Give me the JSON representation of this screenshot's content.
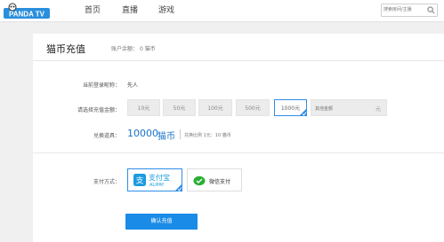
{
  "header": {
    "logo_text": "PANDA TV",
    "nav": [
      "首页",
      "直播",
      "游戏"
    ],
    "search_placeholder": "搜索房间/主播"
  },
  "page": {
    "title": "猫币充值",
    "balance_label": "账户余额：",
    "balance_value": "0",
    "balance_unit": "猫币"
  },
  "form": {
    "nickname_label": "当前登录昵称：",
    "nickname_value": "先人",
    "amount_label": "请选择充值金额：",
    "amounts": [
      "10元",
      "50元",
      "100元",
      "500元",
      "1000元"
    ],
    "selected_amount": "1000元",
    "custom_placeholder": "其他金额",
    "custom_unit": "元",
    "exchange_label": "兑换道具：",
    "exchange_value": "10000",
    "exchange_unit": "猫币",
    "ratio_text": "兑换比例 1元：10 猫币",
    "payment_label": "支付方式：",
    "payment_options": [
      {
        "name": "支付宝",
        "sub": "ALIPAY",
        "selected": true
      },
      {
        "name": "微信支付",
        "selected": false
      }
    ],
    "confirm_label": "确认充值"
  },
  "colors": {
    "accent": "#1b8be8",
    "alipay_blue": "#1a9ae0",
    "wechat_green": "#2aae34"
  }
}
